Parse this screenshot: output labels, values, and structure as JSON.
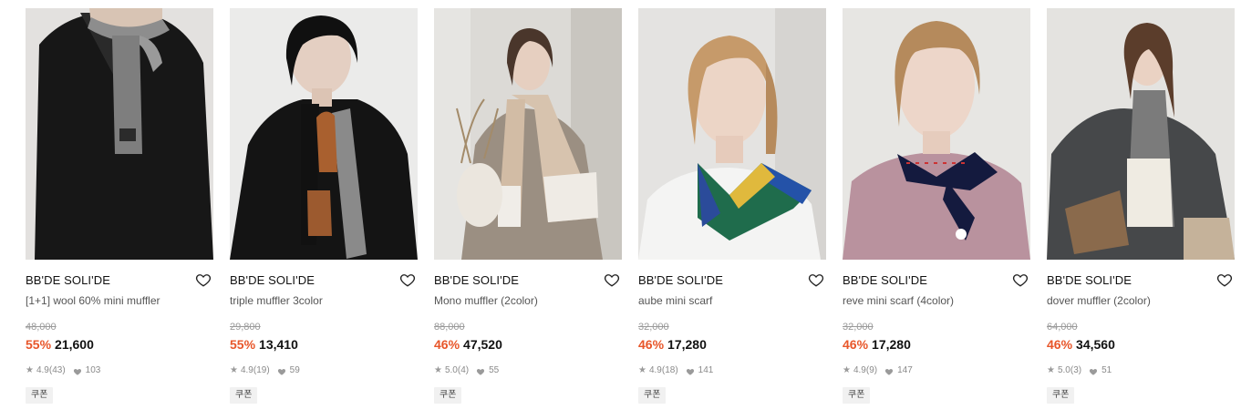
{
  "products": [
    {
      "brand": "BB'DE SOLI'DE",
      "name": "[1+1] wool 60% mini muffler",
      "original_price": "48,000",
      "discount": "55%",
      "price": "21,600",
      "rating": "4.9",
      "reviews": "(43)",
      "likes": "103",
      "coupon": "쿠폰"
    },
    {
      "brand": "BB'DE SOLI'DE",
      "name": "triple muffler 3color",
      "original_price": "29,800",
      "discount": "55%",
      "price": "13,410",
      "rating": "4.9",
      "reviews": "(19)",
      "likes": "59",
      "coupon": "쿠폰"
    },
    {
      "brand": "BB'DE SOLI'DE",
      "name": "Mono muffler (2color)",
      "original_price": "88,000",
      "discount": "46%",
      "price": "47,520",
      "rating": "5.0",
      "reviews": "(4)",
      "likes": "55",
      "coupon": "쿠폰"
    },
    {
      "brand": "BB'DE SOLI'DE",
      "name": "aube mini scarf",
      "original_price": "32,000",
      "discount": "46%",
      "price": "17,280",
      "rating": "4.9",
      "reviews": "(18)",
      "likes": "141",
      "coupon": "쿠폰"
    },
    {
      "brand": "BB'DE SOLI'DE",
      "name": "reve mini scarf (4color)",
      "original_price": "32,000",
      "discount": "46%",
      "price": "17,280",
      "rating": "4.9",
      "reviews": "(9)",
      "likes": "147",
      "coupon": "쿠폰"
    },
    {
      "brand": "BB'DE SOLI'DE",
      "name": "dover muffler (2color)",
      "original_price": "64,000",
      "discount": "46%",
      "price": "34,560",
      "rating": "5.0",
      "reviews": "(3)",
      "likes": "51",
      "coupon": "쿠폰"
    }
  ],
  "colors": {
    "discount": "#e8562a",
    "text": "#111111",
    "muted": "#8a8a8a"
  },
  "icons": {
    "wishlist": "heart-outline-icon",
    "rating": "star-icon",
    "likes": "heart-filled-icon"
  }
}
